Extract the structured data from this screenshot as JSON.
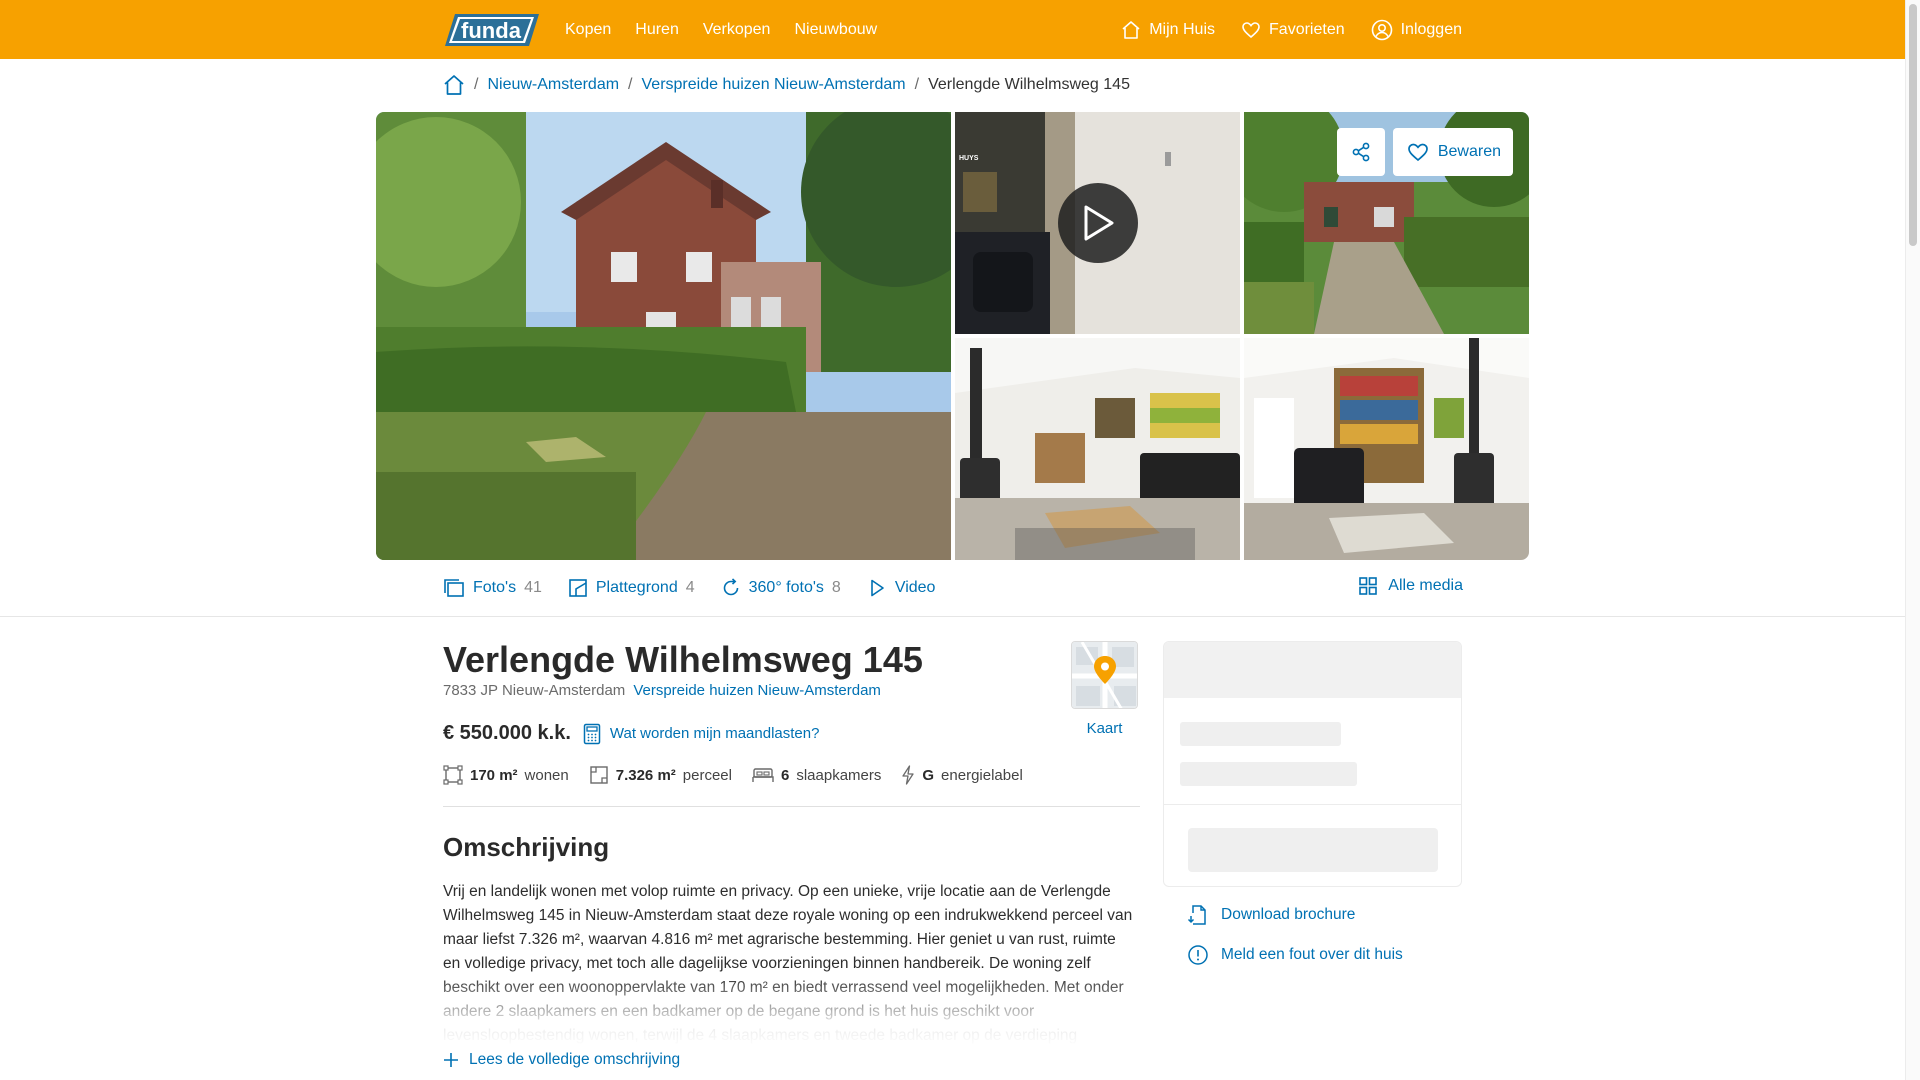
{
  "header": {
    "logo_text": "funda",
    "nav": [
      "Kopen",
      "Huren",
      "Verkopen",
      "Nieuwbouw"
    ],
    "right": {
      "mijn_huis": "Mijn Huis",
      "favorieten": "Favorieten",
      "inloggen": "Inloggen"
    },
    "brand_color": "#f7a100"
  },
  "breadcrumb": {
    "items": [
      "Nieuw-Amsterdam",
      "Verspreide huizen Nieuw-Amsterdam"
    ],
    "current": "Verlengde Wilhelmsweg 145"
  },
  "gallery": {
    "video_watermark": "HUYS",
    "save_label": "Bewaren"
  },
  "media": {
    "photos_label": "Foto's",
    "photos_count": "41",
    "floorplan_label": "Plattegrond",
    "floorplan_count": "4",
    "pano_label": "360° foto's",
    "pano_count": "8",
    "video_label": "Video",
    "all_label": "Alle media"
  },
  "listing": {
    "title": "Verlengde Wilhelmsweg 145",
    "postal": "7833 JP Nieuw-Amsterdam",
    "area_link": "Verspreide huizen Nieuw-Amsterdam",
    "price": "€ 550.000 k.k.",
    "costs_link": "Wat worden mijn maandlasten?",
    "map_label": "Kaart",
    "features": {
      "living_value": "170 m²",
      "living_label": "wonen",
      "plot_value": "7.326 m²",
      "plot_label": "perceel",
      "bedrooms_value": "6",
      "bedrooms_label": "slaapkamers",
      "energy_value": "G",
      "energy_label": "energielabel"
    }
  },
  "description": {
    "heading": "Omschrijving",
    "text": "Vrij en landelijk wonen met volop ruimte en privacy. Op een unieke, vrije locatie aan de Verlengde Wilhelmsweg 145 in Nieuw-Amsterdam staat deze royale woning op een indrukwekkend perceel van maar liefst 7.326 m², waarvan 4.816 m² met agrarische bestemming. Hier geniet u van rust, ruimte en volledige privacy, met toch alle dagelijkse voorzieningen binnen handbereik. De woning zelf beschikt over een woonoppervlakte van 170 m² en biedt verrassend veel mogelijkheden. Met onder andere 2 slaapkamers en een badkamer op de begane grond is het huis geschikt voor levensloopbestendig wonen, terwijl de 4 slaapkamers en tweede badkamer op de verdieping",
    "read_more": "Lees de volledige omschrijving"
  },
  "sidebar": {
    "download": "Download brochure",
    "report": "Meld een fout over dit huis"
  }
}
